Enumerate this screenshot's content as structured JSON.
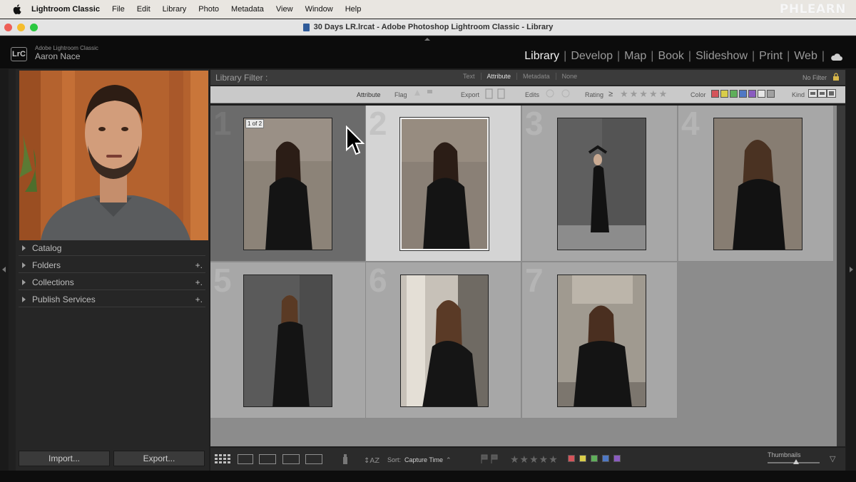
{
  "menubar": {
    "app": "Lightroom Classic",
    "items": [
      "File",
      "Edit",
      "Library",
      "Photo",
      "Metadata",
      "View",
      "Window",
      "Help"
    ],
    "watermark": "PHLEARN"
  },
  "window": {
    "title": "30 Days LR.lrcat - Adobe Photoshop Lightroom Classic - Library"
  },
  "identity": {
    "logo": "LrC",
    "product": "Adobe Lightroom Classic",
    "user": "Aaron Nace"
  },
  "modules": {
    "items": [
      "Library",
      "Develop",
      "Map",
      "Book",
      "Slideshow",
      "Print",
      "Web"
    ],
    "active": "Library"
  },
  "left_panel": {
    "sections": [
      {
        "label": "Catalog",
        "has_plus": false
      },
      {
        "label": "Folders",
        "has_plus": true
      },
      {
        "label": "Collections",
        "has_plus": true
      },
      {
        "label": "Publish Services",
        "has_plus": true
      }
    ],
    "import_label": "Import...",
    "export_label": "Export..."
  },
  "filter": {
    "label": "Library Filter :",
    "tabs": [
      "Text",
      "Attribute",
      "Metadata",
      "None"
    ],
    "active_tab": "Attribute",
    "preset": "No Filter",
    "attribute_label": "Attribute",
    "flag_label": "Flag",
    "export_label": "Export",
    "edits_label": "Edits",
    "rating_label": "Rating",
    "rating_op": "≥",
    "stars": "★★★★★",
    "color_label": "Color",
    "kind_label": "Kind",
    "color_swatches": [
      "#d4545a",
      "#d9cd4a",
      "#5fae5a",
      "#4f78c4",
      "#8a5cc0",
      "#e6e6e6",
      "#a0a0a0"
    ]
  },
  "grid": {
    "cells": [
      {
        "num": "1",
        "state": "dark",
        "badge": "1 of 2"
      },
      {
        "num": "2",
        "state": "selected"
      },
      {
        "num": "3",
        "state": "normal"
      },
      {
        "num": "4",
        "state": "normal"
      },
      {
        "num": "5",
        "state": "normal"
      },
      {
        "num": "6",
        "state": "normal"
      },
      {
        "num": "7",
        "state": "normal"
      }
    ],
    "badge_text": "1 of 2"
  },
  "toolbar": {
    "sort_label": "Sort:",
    "sort_value": "Capture Time",
    "stars": "★★★★★",
    "thumbnails_label": "Thumbnails",
    "thumbnail_size": 0.55,
    "label_colors": [
      "#d4545a",
      "#d9cd4a",
      "#5fae5a",
      "#4f78c4",
      "#8a5cc0"
    ]
  }
}
